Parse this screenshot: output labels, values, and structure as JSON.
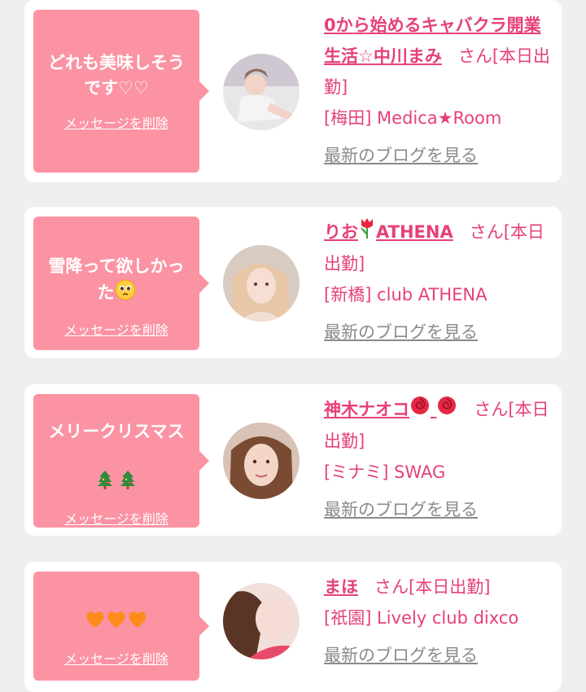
{
  "delete_label": "メッセージを削除",
  "blog_label": "最新のブログを見る",
  "colors": {
    "bubble": "#fb93a3",
    "accent": "#e6407a",
    "link_gray": "#8a8a8a",
    "background": "#efefef"
  },
  "cards": [
    {
      "message": "どれも美味しそうです♡♡",
      "name": "0から始めるキャバクラ開業生活☆中川まみ",
      "suffix": "さん[本日出勤]",
      "shop": "[梅田] Medica★Room"
    },
    {
      "message_text": "雪降って欲しかった",
      "message_emoji": "pleading-face-emoji",
      "name_text": "りお",
      "name_emoji": "tulip-emoji",
      "name_after": "ATHENA",
      "suffix": "さん[本日出勤]",
      "shop": "[新橋] club ATHENA"
    },
    {
      "message_text": "メリークリスマス",
      "message_emoji": "christmas-tree-emoji x2",
      "name_text": "神木ナオコ",
      "name_emoji": "rose-emoji x2",
      "suffix": "さん[本日出勤]",
      "shop": "[ミナミ] SWAG"
    },
    {
      "message_emoji": "orange-heart-emoji x3",
      "name": "まほ",
      "suffix": "さん[本日出勤]",
      "shop": "[祇園] Lively club dixco"
    }
  ]
}
